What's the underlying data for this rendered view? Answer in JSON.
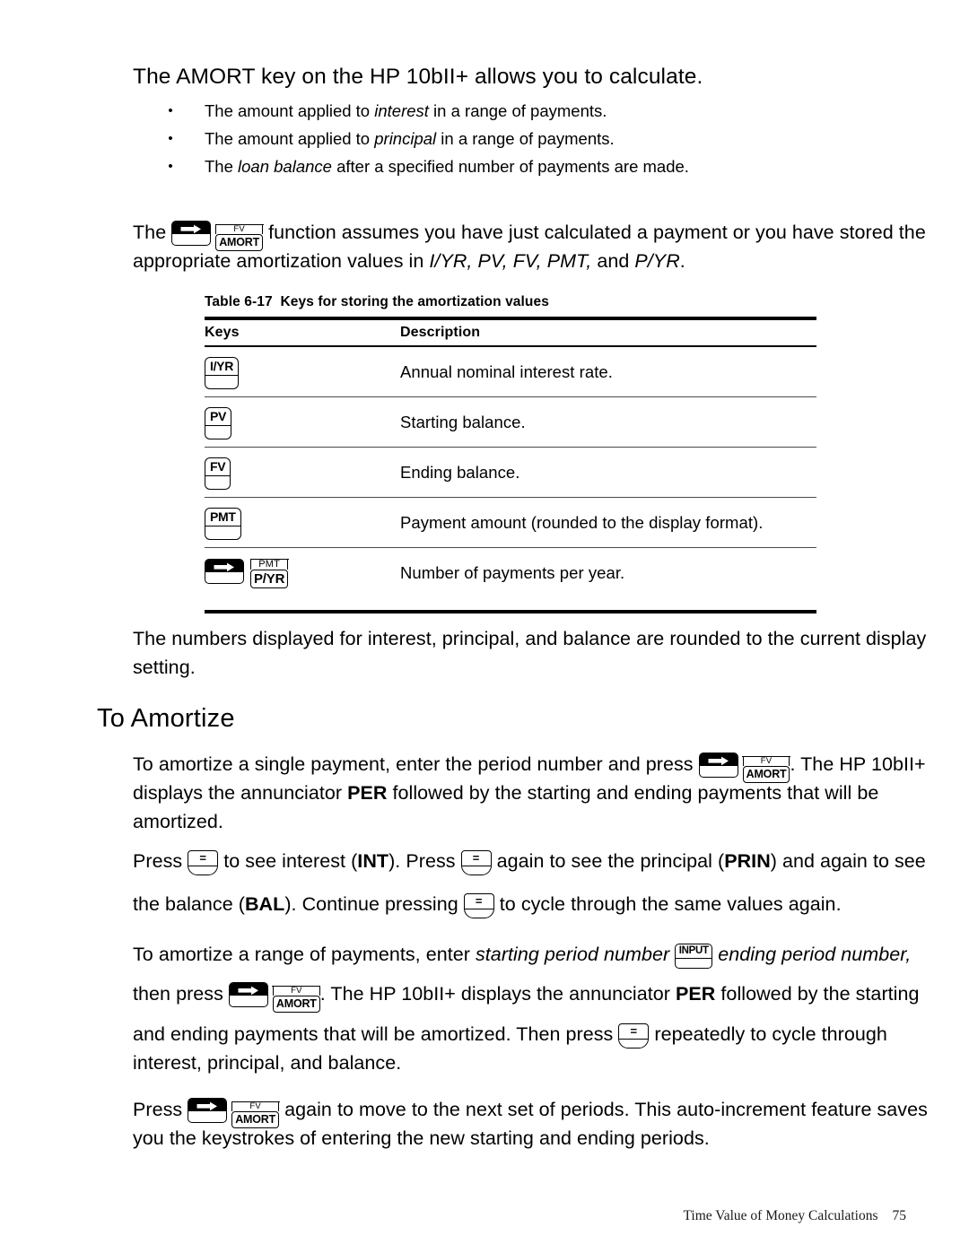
{
  "page": {
    "intro_line": "The AMORT key on the HP 10bII+ allows you to calculate.",
    "bullets": [
      {
        "dot": "•",
        "pre": "The amount applied to ",
        "em": "interest",
        "post": " in a range of payments."
      },
      {
        "dot": "•",
        "pre": "The amount applied to ",
        "em": "principal",
        "post": " in a range of payments."
      },
      {
        "dot": "•",
        "pre": "The ",
        "em": "loan balance",
        "post": " after a specified number of payments are made."
      }
    ]
  },
  "para_amort_fn": {
    "l1_a": "The ",
    "l1_b": " function assumes you have just calculated a payment or you have stored the",
    "l2": "appropriate amortization values in I/YR, PV, FV, PMT, and P/YR."
  },
  "table": {
    "caption_label": "Table 6-17",
    "caption_text": "Keys for storing the amortization values",
    "headers": {
      "keys": "Keys",
      "description": "Description"
    },
    "rows": [
      {
        "key_type": "plate",
        "key_label": "I/YR",
        "description": "Annual nominal interest rate."
      },
      {
        "key_type": "plate",
        "key_label": "PV",
        "description": "Starting balance."
      },
      {
        "key_type": "plate",
        "key_label": "FV",
        "description": "Ending balance."
      },
      {
        "key_type": "plate",
        "key_label": "PMT",
        "description": "Payment amount (rounded to the display format)."
      },
      {
        "key_type": "shift-plate",
        "key_sub": "PMT",
        "key_label": "P/YR",
        "description": "Number of payments per year."
      }
    ]
  },
  "para_rounding": {
    "l1": "The numbers displayed for interest, principal, and balance are rounded to the current display",
    "l2": "setting."
  },
  "heading_amortize": "To Amortize",
  "para_single": {
    "l1_a": "To amortize a single payment, enter the period number and press ",
    "l1_b": ". The HP 10bII+",
    "l2_a": "displays the annunciator ",
    "l2_b": "PER",
    "l2_c": " followed by the starting and ending payments that will be",
    "l3": "amortized."
  },
  "para_press_eq": {
    "l1_a": "Press ",
    "l1_b": " to see interest (",
    "l1_int": "INT",
    "l1_c": "). Press ",
    "l1_d": " again to see the principal (",
    "l1_prin": "PRIN",
    "l1_e": ") and again to see",
    "l2_a": "the balance (",
    "l2_bal": "BAL",
    "l2_b": "). Continue pressing ",
    "l2_c": " to cycle through the same values again."
  },
  "para_range": {
    "l1_a": "To amortize a range of payments, enter ",
    "l1_em1": "starting period number",
    "l1_b": " ",
    "l1_em2": "ending period number,",
    "l2_a": "then press ",
    "l2_b": ". The HP 10bII+ displays the annunciator ",
    "l2_per": "PER",
    "l2_c": " followed by the starting",
    "l3_a": "and ending payments that will be amortized. Then press ",
    "l3_b": " repeatedly to cycle through",
    "l4": "interest, principal, and balance."
  },
  "para_again": {
    "l1_a": "Press ",
    "l1_b": " again to move to the next set of periods. This auto-increment feature saves",
    "l2": "you the keystrokes of entering the new starting and ending periods."
  },
  "keys": {
    "shift": "shift-key",
    "amort_sub": "FV",
    "amort_main": "AMORT",
    "pyr_sub": "PMT",
    "pyr_main": "P/YR",
    "input_label": "INPUT",
    "equals_label": "=",
    "colors": {
      "key_black": "#000000",
      "key_face": "#ffffff"
    }
  },
  "footer": {
    "title": "Time Value of Money Calculations",
    "page_number": "75"
  }
}
